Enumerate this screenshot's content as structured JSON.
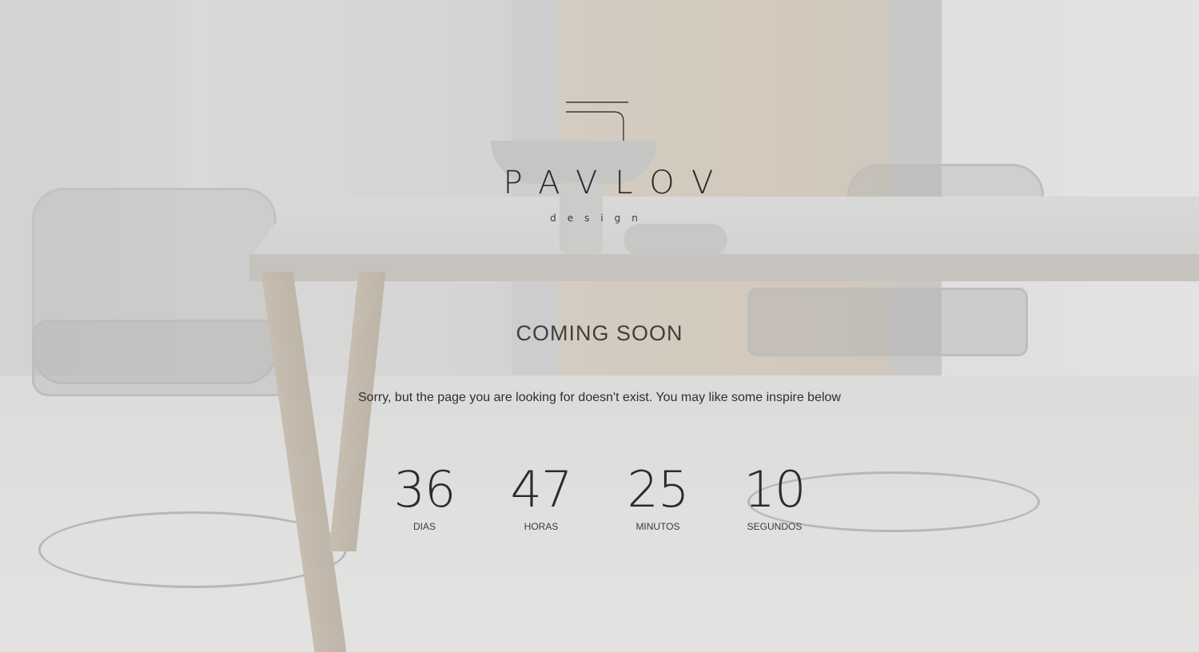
{
  "brand": {
    "name": "PAVLOV",
    "tagline": "design"
  },
  "page": {
    "title": "COMING SOON",
    "message": "Sorry, but the page you are looking for doesn't exist. You may like some inspire below"
  },
  "countdown": {
    "days": {
      "value": "36",
      "label": "DIAS"
    },
    "hours": {
      "value": "47",
      "label": "HORAS"
    },
    "minutes": {
      "value": "25",
      "label": "MINUTOS"
    },
    "seconds": {
      "value": "10",
      "label": "SEGUNDOS"
    }
  },
  "colors": {
    "text": "#2b2b2b",
    "overlay": "#e6e6e6"
  },
  "icons": {
    "logo_mark": "pavlov-logo-mark-icon"
  }
}
